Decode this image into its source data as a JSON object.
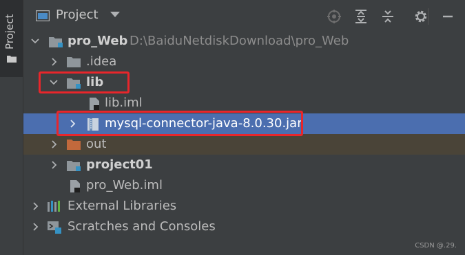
{
  "sidebar": {
    "tab_label": "Project"
  },
  "header": {
    "title": "Project"
  },
  "tree": [
    {
      "label": "pro_Web",
      "path": "D:\\BaiduNetdiskDownload\\pro_Web"
    },
    {
      "label": ".idea"
    },
    {
      "label": "lib"
    },
    {
      "label": "lib.iml"
    },
    {
      "label": "mysql-connector-java-8.0.30.jar"
    },
    {
      "label": "out"
    },
    {
      "label": "project01"
    },
    {
      "label": "pro_Web.iml"
    },
    {
      "label": "External Libraries"
    },
    {
      "label": "Scratches and Consoles"
    }
  ],
  "watermark": "CSDN @.29.",
  "colors": {
    "selection": "#4b6eaf",
    "excluded": "#4a4438",
    "highlight": "#e8262b",
    "folder": "#8f969b",
    "out_folder": "#c2693c"
  }
}
